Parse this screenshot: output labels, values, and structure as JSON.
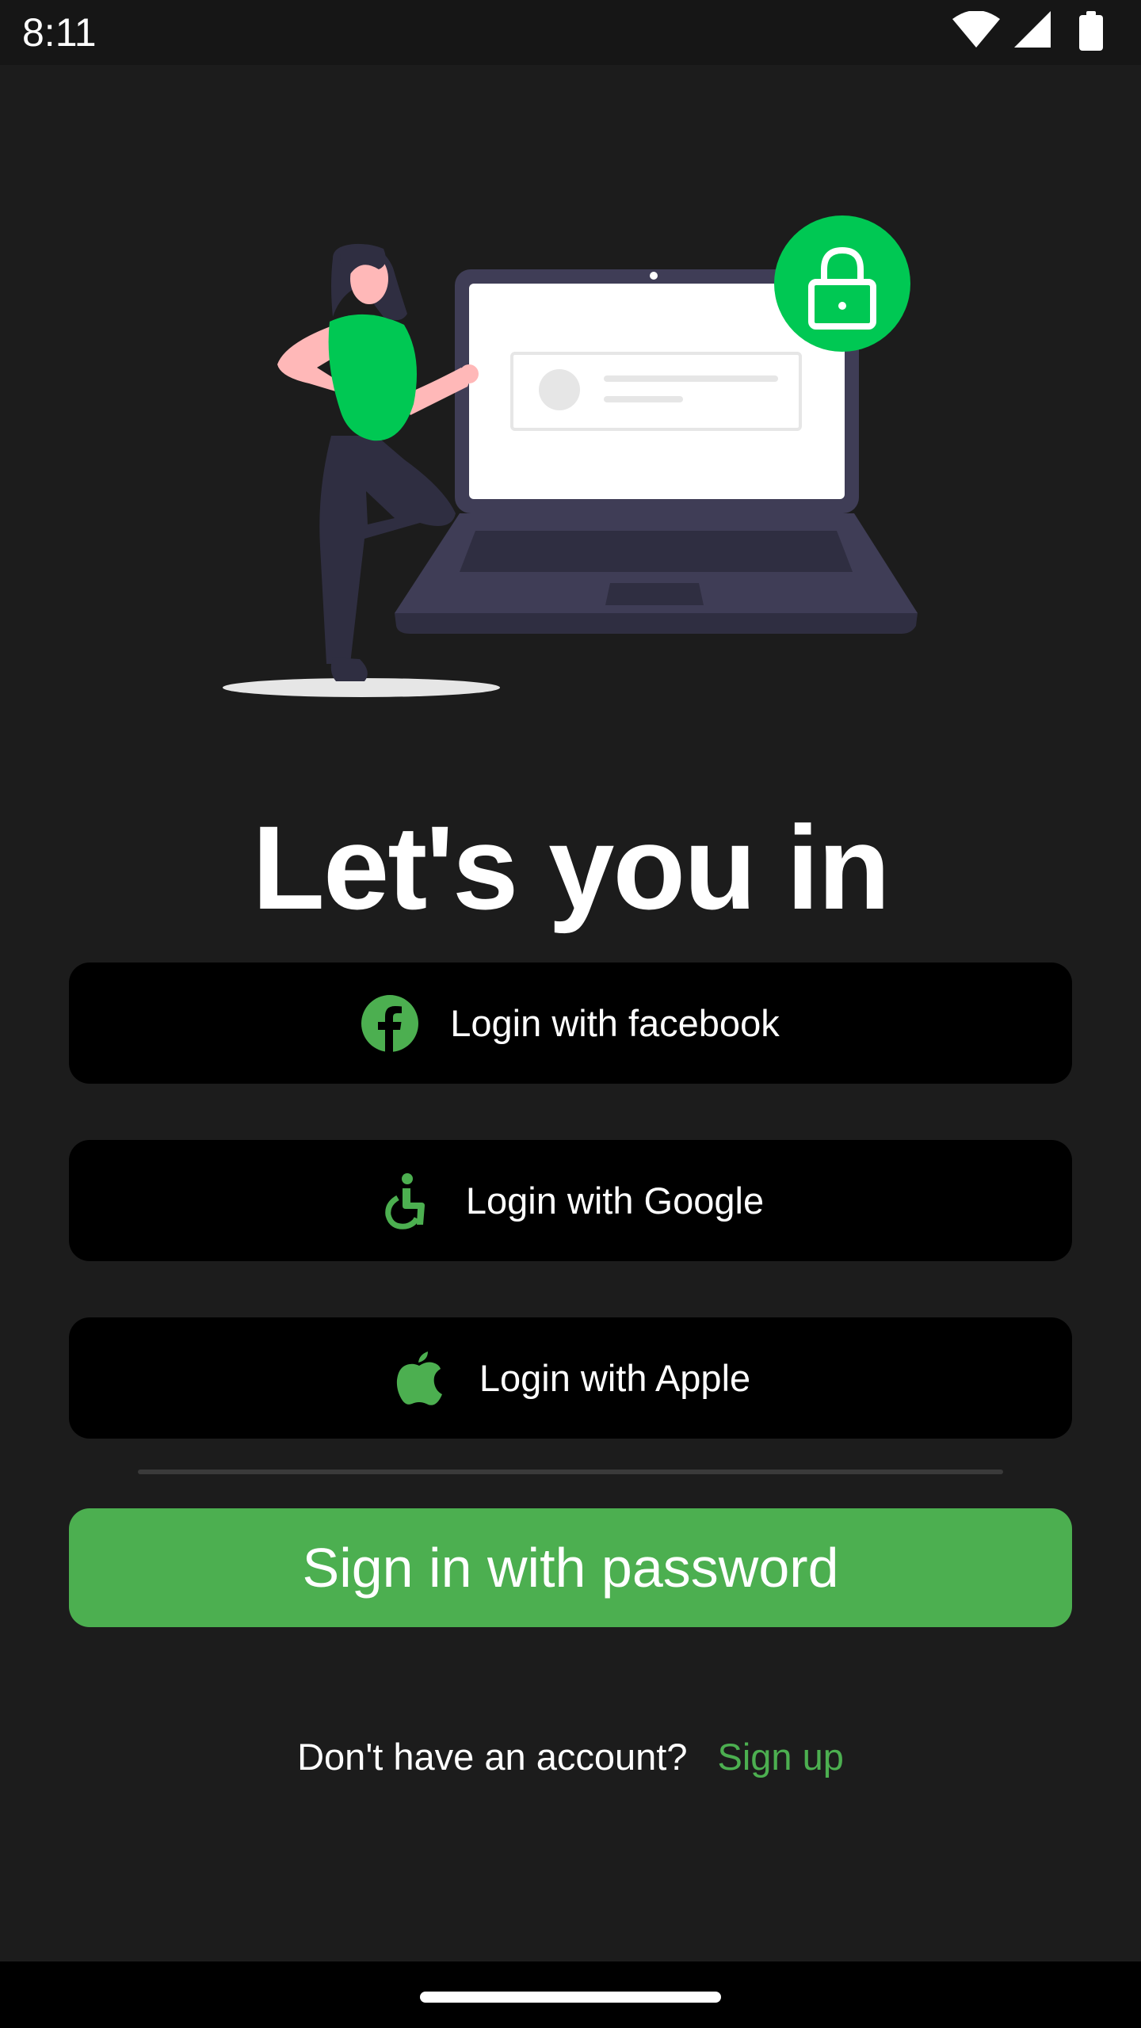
{
  "status_bar": {
    "time": "8:11"
  },
  "hero": {
    "illustration": "woman-with-laptop-lock-illustration"
  },
  "title": "Let's you in",
  "buttons": {
    "facebook": {
      "label": "Login with facebook",
      "icon": "facebook-icon"
    },
    "google": {
      "label": "Login with Google",
      "icon": "accessibility-icon"
    },
    "apple": {
      "label": "Login with Apple",
      "icon": "apple-icon"
    },
    "password": {
      "label": "Sign in with password"
    }
  },
  "footer": {
    "prompt": "Don't have an account?",
    "signup_link": "Sign up"
  },
  "colors": {
    "background": "#1c1c1c",
    "accent": "#4caf50",
    "button_bg": "#000000",
    "illustration_green": "#00c853"
  }
}
